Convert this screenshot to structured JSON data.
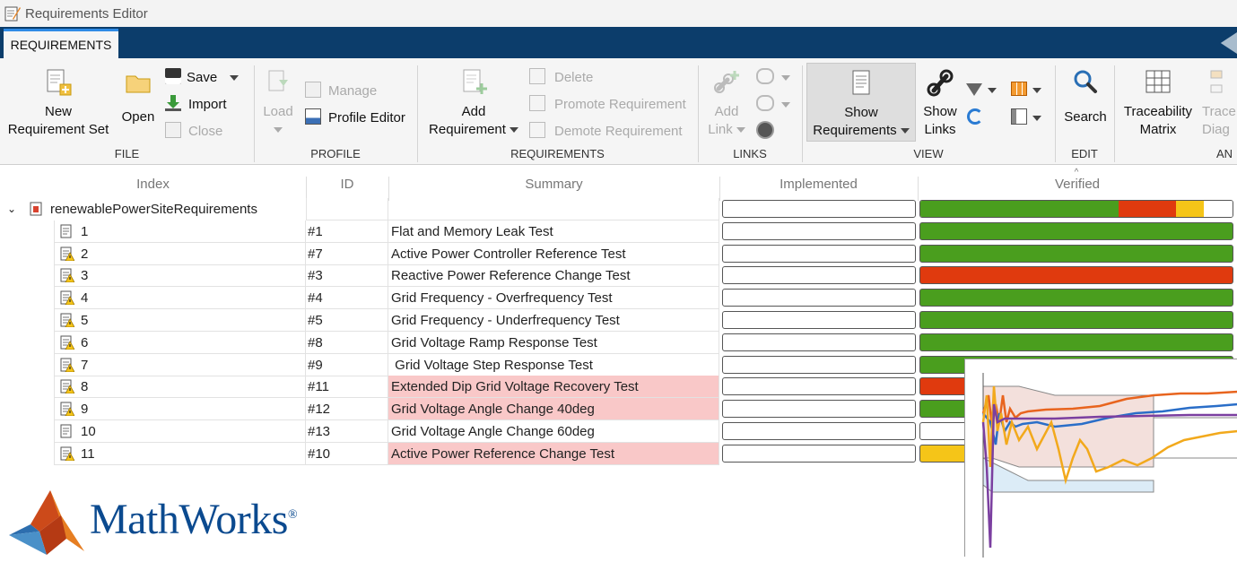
{
  "window": {
    "title": "Requirements Editor"
  },
  "tab": {
    "label": "REQUIREMENTS"
  },
  "ribbon": {
    "file": {
      "new_line1": "New",
      "new_line2": "Requirement Set",
      "open": "Open",
      "save": "Save",
      "import": "Import",
      "close": "Close",
      "section": "FILE"
    },
    "profile": {
      "load": "Load",
      "manage": "Manage",
      "profile_editor": "Profile Editor",
      "section": "PROFILE"
    },
    "requirements": {
      "add_line1": "Add",
      "add_line2": "Requirement",
      "delete": "Delete",
      "promote": "Promote Requirement",
      "demote": "Demote Requirement",
      "section": "REQUIREMENTS"
    },
    "links": {
      "add_line1": "Add",
      "add_line2": "Link",
      "section": "LINKS"
    },
    "view": {
      "show_req_line1": "Show",
      "show_req_line2": "Requirements",
      "show_links_line1": "Show",
      "show_links_line2": "Links",
      "section": "VIEW"
    },
    "edit": {
      "search": "Search",
      "section": "EDIT"
    },
    "analysis": {
      "trace_line1": "Traceability",
      "trace_line2": "Matrix",
      "trace_diag_line1": "Trace",
      "trace_diag_line2": "Diag",
      "section": "AN"
    }
  },
  "table": {
    "headers": {
      "index": "Index",
      "id": "ID",
      "summary": "Summary",
      "implemented": "Implemented",
      "verified": "Verified"
    },
    "root": {
      "label": "renewablePowerSiteRequirements",
      "verified": {
        "passed": 0.636,
        "failed": 0.182,
        "unexecuted": 0.091,
        "none": 0.091
      }
    },
    "rows": [
      {
        "index": "1",
        "id": "#1",
        "summary": "Flat and Memory Leak Test",
        "warn": false,
        "fail": false,
        "verified": "passed"
      },
      {
        "index": "2",
        "id": "#7",
        "summary": "Active Power Controller Reference Test",
        "warn": true,
        "fail": false,
        "verified": "passed"
      },
      {
        "index": "3",
        "id": "#3",
        "summary": "Reactive Power Reference Change Test",
        "warn": true,
        "fail": false,
        "verified": "failed"
      },
      {
        "index": "4",
        "id": "#4",
        "summary": "Grid Frequency - Overfrequency Test",
        "warn": true,
        "fail": false,
        "verified": "passed"
      },
      {
        "index": "5",
        "id": "#5",
        "summary": "Grid Frequency - Underfrequency Test",
        "warn": true,
        "fail": false,
        "verified": "passed"
      },
      {
        "index": "6",
        "id": "#8",
        "summary": "Grid Voltage Ramp Response Test",
        "warn": true,
        "fail": false,
        "verified": "passed"
      },
      {
        "index": "7",
        "id": "#9",
        "summary": " Grid Voltage Step Response Test",
        "warn": true,
        "fail": false,
        "verified": "passed"
      },
      {
        "index": "8",
        "id": "#11",
        "summary": "Extended Dip Grid Voltage Recovery Test",
        "warn": true,
        "fail": true,
        "verified": "failed"
      },
      {
        "index": "9",
        "id": "#12",
        "summary": "Grid Voltage Angle Change 40deg",
        "warn": true,
        "fail": true,
        "verified": "passed"
      },
      {
        "index": "10",
        "id": "#13",
        "summary": "Grid Voltage Angle Change 60deg",
        "warn": false,
        "fail": false,
        "verified": "none"
      },
      {
        "index": "11",
        "id": "#10",
        "summary": "Active Power Reference Change Test",
        "warn": true,
        "fail": true,
        "verified": "unexecuted"
      }
    ]
  },
  "colors": {
    "passed": "#4a9e1e",
    "failed": "#e03a0e",
    "unexecuted": "#f5c518",
    "tab_bar": "#0c3d6b",
    "fail_row": "#f9c8c8",
    "brand": "#0b4a8f"
  },
  "logo": {
    "wordmark": "MathWorks",
    "registered": "®"
  }
}
